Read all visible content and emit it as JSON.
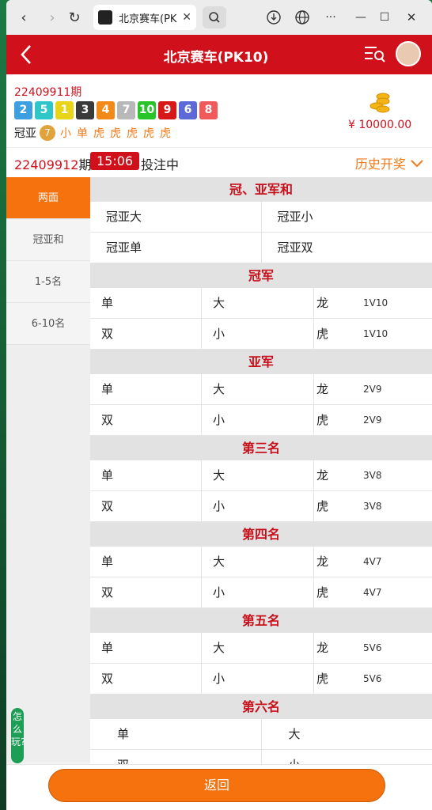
{
  "browser": {
    "tab_title": "北京赛车(PK",
    "tab_close": "✕",
    "nav_back": "‹",
    "nav_forward": "›",
    "reload": "↻",
    "more": "···",
    "minimize": "—",
    "maximize": "☐",
    "close": "✕"
  },
  "header": {
    "title": "北京赛车(PK10)"
  },
  "last_draw": {
    "issue": "22409911期",
    "balls": [
      {
        "n": "2",
        "color": "#3c9fe0"
      },
      {
        "n": "5",
        "color": "#2ec6c9"
      },
      {
        "n": "1",
        "color": "#e8d51a"
      },
      {
        "n": "3",
        "color": "#3a3a3a"
      },
      {
        "n": "4",
        "color": "#f28a1a"
      },
      {
        "n": "7",
        "color": "#b8b8b8"
      },
      {
        "n": "10",
        "color": "#28c42a"
      },
      {
        "n": "9",
        "color": "#d81818"
      },
      {
        "n": "6",
        "color": "#5b6ad6"
      },
      {
        "n": "8",
        "color": "#f05a5a"
      }
    ],
    "sum_label": "冠亚",
    "sum_value": "7",
    "tags": [
      "小",
      "单",
      "虎",
      "虎",
      "虎",
      "虎",
      "虎"
    ],
    "balance": "¥ 10000.00"
  },
  "current": {
    "issue": "22409912",
    "issue_suffix": "期",
    "timer": "15:06",
    "status": "投注中",
    "history": "历史开奖"
  },
  "sidebar": [
    "两面",
    "冠亚和",
    "1-5名",
    "6-10名"
  ],
  "section_gy": {
    "title": "冠、亚军和",
    "cells": [
      "冠亚大",
      "冠亚小",
      "冠亚单",
      "冠亚双"
    ]
  },
  "rank_sections": [
    {
      "title": "冠军",
      "r1": [
        "单",
        "大",
        "龙",
        "1V10"
      ],
      "r2": [
        "双",
        "小",
        "虎",
        "1V10"
      ]
    },
    {
      "title": "亚军",
      "r1": [
        "单",
        "大",
        "龙",
        "2V9"
      ],
      "r2": [
        "双",
        "小",
        "虎",
        "2V9"
      ]
    },
    {
      "title": "第三名",
      "r1": [
        "单",
        "大",
        "龙",
        "3V8"
      ],
      "r2": [
        "双",
        "小",
        "虎",
        "3V8"
      ]
    },
    {
      "title": "第四名",
      "r1": [
        "单",
        "大",
        "龙",
        "4V7"
      ],
      "r2": [
        "双",
        "小",
        "虎",
        "4V7"
      ]
    },
    {
      "title": "第五名",
      "r1": [
        "单",
        "大",
        "龙",
        "5V6"
      ],
      "r2": [
        "双",
        "小",
        "虎",
        "5V6"
      ]
    }
  ],
  "section_6": {
    "title": "第六名",
    "cells": [
      "单",
      "大",
      "双",
      "小"
    ]
  },
  "how_to": "怎么玩?",
  "footer": {
    "return": "返回"
  }
}
